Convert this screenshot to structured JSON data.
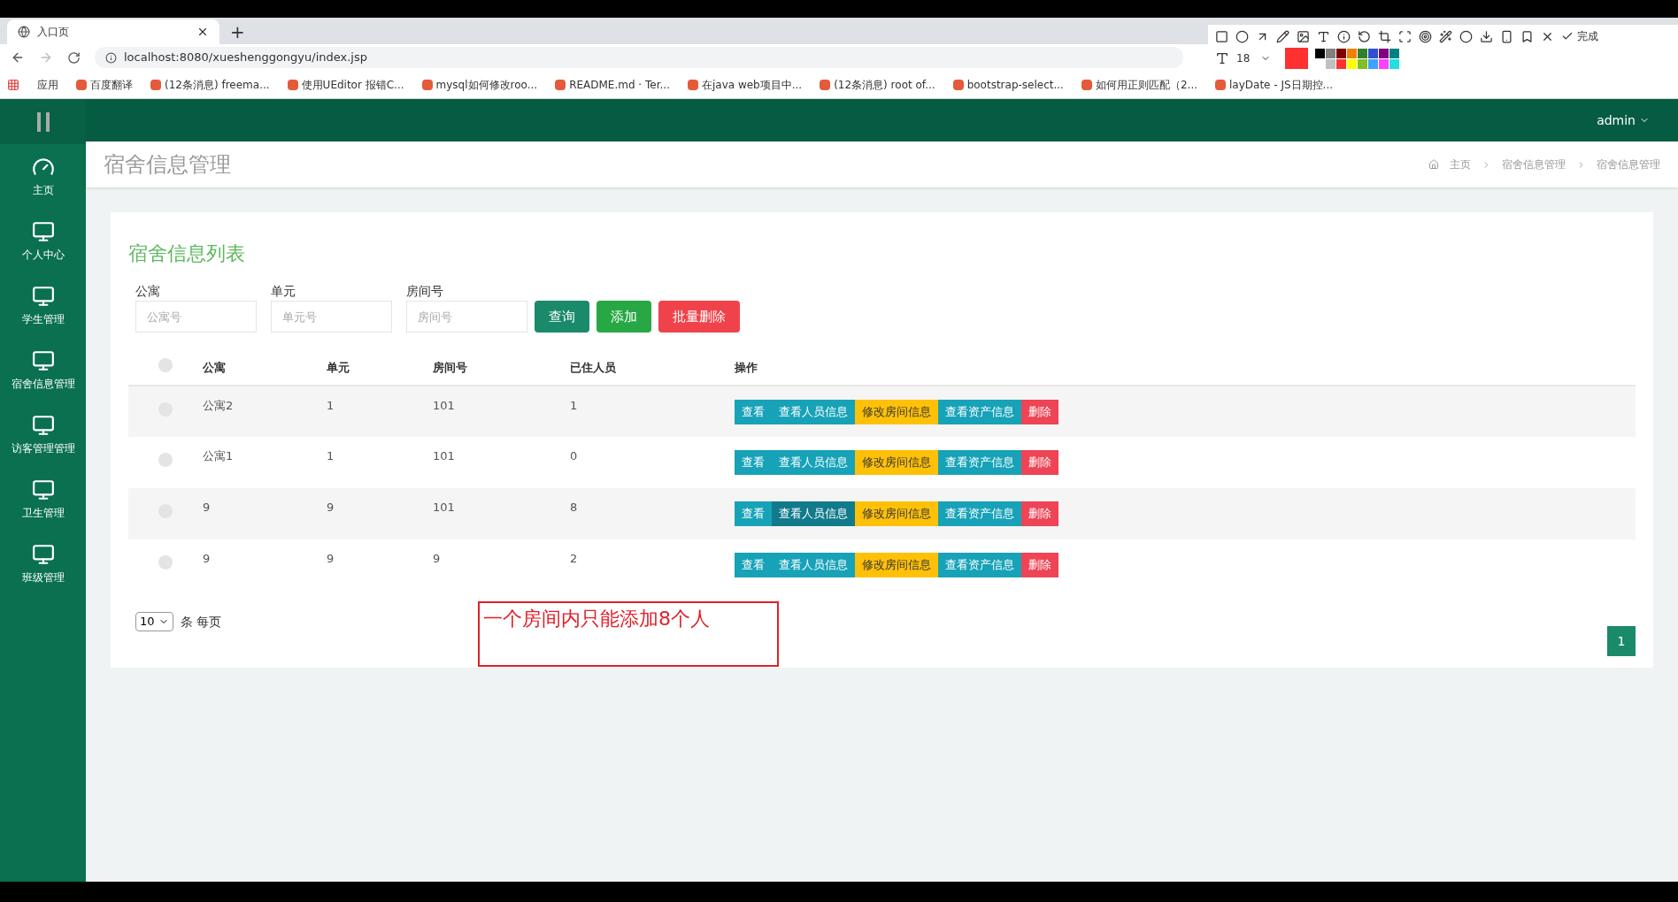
{
  "browser": {
    "tab_title": "入口页",
    "new_tab": "+",
    "url": "localhost:8080/xueshenggongyu/index.jsp",
    "bookmarks": [
      "应用",
      "百度翻译",
      "(12条消息) freema...",
      "使用UEditor 报错C...",
      "mysql如何修改roo...",
      "README.md · Ter...",
      "在java web项目中...",
      "(12条消息) root of...",
      "bootstrap-select...",
      "如何用正则匹配（2...",
      "layDate - JS日期控..."
    ]
  },
  "capture_toolbar": {
    "done": "完成",
    "font_size": "18"
  },
  "header": {
    "user": "admin"
  },
  "sidebar": {
    "items": [
      {
        "label": "主页",
        "kind": "dashboard",
        "selected": false
      },
      {
        "label": "个人中心",
        "kind": "monitor",
        "selected": false
      },
      {
        "label": "学生管理",
        "kind": "monitor",
        "selected": false
      },
      {
        "label": "宿舍信息管理",
        "kind": "monitor",
        "selected": false
      },
      {
        "label": "访客管理管理",
        "kind": "monitor",
        "selected": false
      },
      {
        "label": "卫生管理",
        "kind": "monitor",
        "selected": false
      },
      {
        "label": "班级管理",
        "kind": "monitor",
        "selected": false
      }
    ]
  },
  "page": {
    "title": "宿舍信息管理",
    "breadcrumb": [
      "主页",
      "宿舍信息管理",
      "宿舍信息管理"
    ]
  },
  "card": {
    "title": "宿舍信息列表",
    "filters": [
      {
        "label": "公寓",
        "placeholder": "公寓号"
      },
      {
        "label": "单元",
        "placeholder": "单元号"
      },
      {
        "label": "房间号",
        "placeholder": "房间号"
      }
    ],
    "buttons": [
      {
        "label": "查询",
        "kind": "primary"
      },
      {
        "label": "添加",
        "kind": "success"
      },
      {
        "label": "批量删除",
        "kind": "danger"
      }
    ],
    "table": {
      "select_all": {
        "checked": false
      },
      "columns": [
        "公寓",
        "单元",
        "房间号",
        "已住人员",
        "操作"
      ],
      "rows": [
        {
          "checked": false,
          "cells": [
            "公寓2",
            "1",
            "101",
            "1"
          ],
          "actions": [
            {
              "label": "查看",
              "kind": "info"
            },
            {
              "label": "查看人员信息",
              "kind": "info"
            },
            {
              "label": "修改房间信息",
              "kind": "warning"
            },
            {
              "label": "查看资产信息",
              "kind": "info"
            },
            {
              "label": "删除",
              "kind": "danger"
            }
          ]
        },
        {
          "checked": false,
          "cells": [
            "公寓1",
            "1",
            "101",
            "0"
          ],
          "actions": [
            {
              "label": "查看",
              "kind": "info"
            },
            {
              "label": "查看人员信息",
              "kind": "info"
            },
            {
              "label": "修改房间信息",
              "kind": "warning"
            },
            {
              "label": "查看资产信息",
              "kind": "info"
            },
            {
              "label": "删除",
              "kind": "danger"
            }
          ]
        },
        {
          "checked": false,
          "cells": [
            "9",
            "9",
            "101",
            "8"
          ],
          "actions": [
            {
              "label": "查看",
              "kind": "info"
            },
            {
              "label": "查看人员信息",
              "kind": "info-hover"
            },
            {
              "label": "修改房间信息",
              "kind": "warning"
            },
            {
              "label": "查看资产信息",
              "kind": "info"
            },
            {
              "label": "删除",
              "kind": "danger"
            }
          ]
        },
        {
          "checked": false,
          "cells": [
            "9",
            "9",
            "9",
            "2"
          ],
          "actions": [
            {
              "label": "查看",
              "kind": "info"
            },
            {
              "label": "查看人员信息",
              "kind": "info"
            },
            {
              "label": "修改房间信息",
              "kind": "warning"
            },
            {
              "label": "查看资产信息",
              "kind": "info"
            },
            {
              "label": "删除",
              "kind": "danger"
            }
          ]
        }
      ]
    },
    "page_size": {
      "value": "10",
      "suffix": "条 每页"
    },
    "pagination": [
      {
        "label": "1",
        "selected": true
      }
    ]
  },
  "annotation": {
    "text": "一个房间内只能添加8个人"
  }
}
